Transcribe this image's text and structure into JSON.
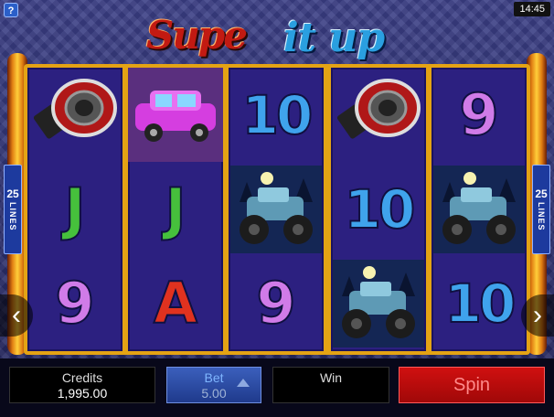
{
  "clock": "14:45",
  "help_label": "?",
  "logo": {
    "word1": "Supe",
    "word2": "it up"
  },
  "lines_badge": {
    "number": "25",
    "word": "LINES"
  },
  "nav": {
    "prev": "‹",
    "next": "›"
  },
  "reels": [
    [
      "speaker-icon",
      "J",
      "9"
    ],
    [
      "limo-icon",
      "J",
      "A"
    ],
    [
      "10",
      "monster-truck-icon",
      "9"
    ],
    [
      "speaker-icon",
      "10",
      "monster-truck-icon"
    ],
    [
      "9",
      "monster-truck-icon",
      "10"
    ]
  ],
  "credits": {
    "label": "Credits",
    "value": "1,995.00"
  },
  "bet": {
    "label": "Bet",
    "value": "5.00"
  },
  "win": {
    "label": "Win",
    "value": ""
  },
  "spin": {
    "label": "Spin"
  },
  "colors": {
    "ten": "#3fa3ec",
    "nine": "#d07be8",
    "jack": "#46c03c",
    "ace": "#e0321f",
    "spin": "#c00a0a"
  }
}
